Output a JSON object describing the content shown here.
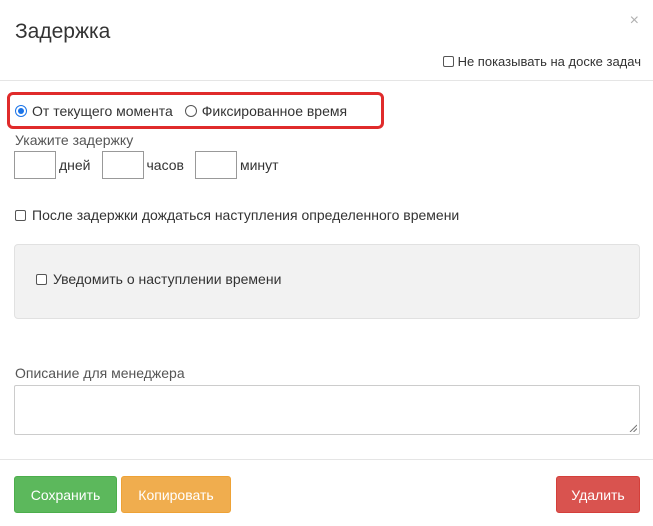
{
  "dialog": {
    "title": "Задержка",
    "close_icon": "×",
    "hide_on_board_label": "Не показывать на доске задач"
  },
  "mode": {
    "options": [
      {
        "label": "От текущего момента",
        "checked": true
      },
      {
        "label": "Фиксированное время",
        "checked": false
      }
    ]
  },
  "delay": {
    "label": "Укажите задержку",
    "days": {
      "value": "",
      "unit": "дней"
    },
    "hours": {
      "value": "",
      "unit": "часов"
    },
    "minutes": {
      "value": "",
      "unit": "минут"
    }
  },
  "wait_for_time": {
    "label": "После задержки дождаться наступления определенного времени",
    "checked": false
  },
  "notify": {
    "label": "Уведомить о наступлении времени",
    "checked": false
  },
  "description": {
    "label": "Описание для менеджера",
    "value": ""
  },
  "footer": {
    "save_label": "Сохранить",
    "copy_label": "Копировать",
    "delete_label": "Удалить"
  },
  "colors": {
    "save": "#5cb85c",
    "copy": "#f0ad4e",
    "delete": "#d9534f",
    "highlight": "#e02b2b",
    "radio_accent": "#1a73e8"
  }
}
